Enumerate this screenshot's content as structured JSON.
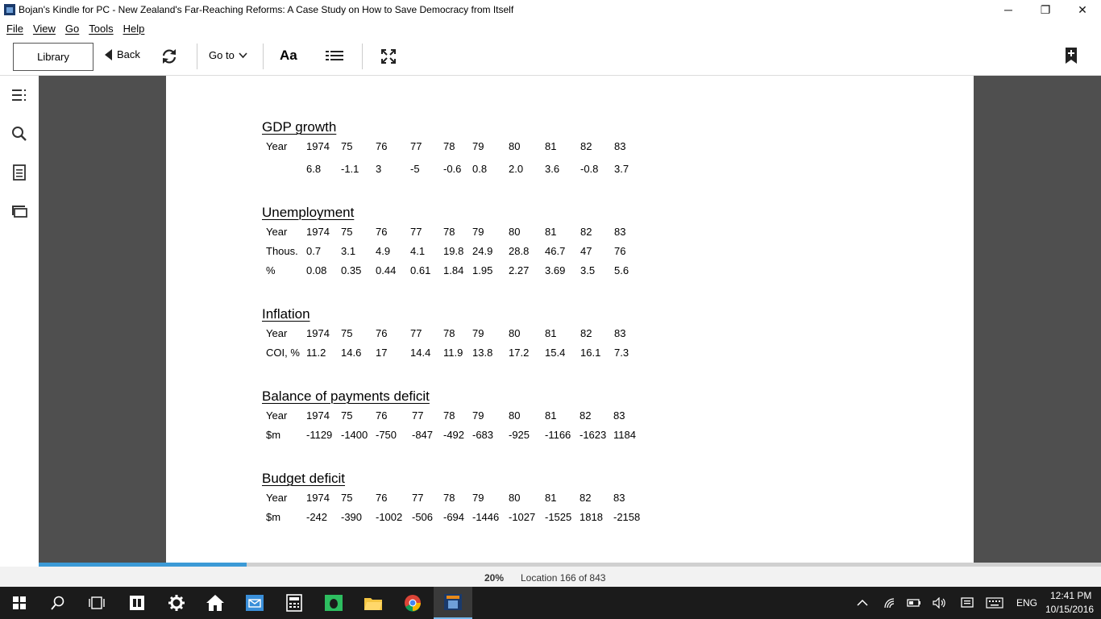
{
  "window": {
    "title": "Bojan's Kindle for PC - New Zealand's Far-Reaching Reforms: A Case Study on How to Save Democracy from Itself",
    "minimize": "─",
    "restore": "❐",
    "close": "✕"
  },
  "menu": [
    "File",
    "View",
    "Go",
    "Tools",
    "Help"
  ],
  "toolbar": {
    "library": "Library",
    "back": "Back",
    "goto": "Go to",
    "font": "Aa"
  },
  "book": {
    "sections": [
      {
        "title": "GDP growth",
        "rows": [
          [
            "Year",
            "1974",
            "75",
            "76",
            "77",
            "78",
            "79",
            "80",
            "81",
            "82",
            "83"
          ],
          [
            "",
            "6.8",
            "-1.1",
            "3",
            "-5",
            "-0.6",
            "0.8",
            "2.0",
            "3.6",
            "-0.8",
            "3.7"
          ]
        ]
      },
      {
        "title": "Unemployment",
        "rows": [
          [
            "Year",
            "1974",
            "75",
            "76",
            "77",
            "78",
            "79",
            "80",
            "81",
            "82",
            "83"
          ],
          [
            "Thous.",
            "0.7",
            "3.1",
            "4.9",
            "4.1",
            "19.8",
            "24.9",
            "28.8",
            "46.7",
            "47",
            "76"
          ],
          [
            "%",
            "0.08",
            "0.35",
            "0.44",
            "0.61",
            "1.84",
            "1.95",
            "2.27",
            "3.69",
            "3.5",
            "5.6"
          ]
        ]
      },
      {
        "title": "Inflation",
        "rows": [
          [
            "Year",
            "1974",
            "75",
            "76",
            "77",
            "78",
            "79",
            "80",
            "81",
            "82",
            "83"
          ],
          [
            "COI, %",
            "11.2",
            "14.6",
            "17",
            "14.4",
            "11.9",
            "13.8",
            "17.2",
            "15.4",
            "16.1",
            "7.3"
          ]
        ]
      },
      {
        "title": "Balance of payments deficit",
        "rows": [
          [
            "Year",
            "1974",
            "75",
            "76",
            "77",
            "78",
            "79",
            "80",
            "81",
            "82",
            "83"
          ],
          [
            "$m",
            "-1129",
            "-1400",
            "-750",
            "-847",
            "-492",
            "-683",
            "-925",
            "-1166",
            "-1623",
            "1184"
          ]
        ]
      },
      {
        "title": "Budget deficit",
        "rows": [
          [
            "Year",
            "1974",
            "75",
            "76",
            "77",
            "78",
            "79",
            "80",
            "81",
            "82",
            "83"
          ],
          [
            "$m",
            "-242",
            "-390",
            "-1002",
            "-506",
            "-694",
            "-1446",
            "-1027",
            "-1525",
            "1818",
            "-2158"
          ]
        ]
      }
    ]
  },
  "status": {
    "percent": "20%",
    "progress_fraction": 0.2,
    "location": "Location 166 of 843"
  },
  "taskbar": {
    "time": "12:41 PM",
    "date": "10/15/2016",
    "lang": "ENG",
    "accent": "#76b9ed"
  }
}
